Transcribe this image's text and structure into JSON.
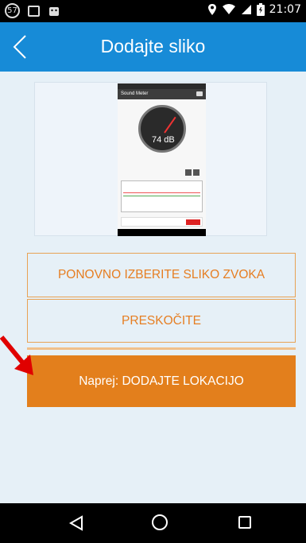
{
  "status_bar": {
    "badge": "57",
    "time": "21:07"
  },
  "app_bar": {
    "title": "Dodajte sliko"
  },
  "preview": {
    "phone_title": "Sound Meter",
    "reading": "74 dB"
  },
  "buttons": {
    "reselect": "PONOVNO IZBERITE SLIKO ZVOKA",
    "skip": "PRESKOČITE",
    "next": "Naprej: DODAJTE LOKACIJO"
  },
  "colors": {
    "app_bar": "#178bd7",
    "accent": "#e37f1c",
    "background": "#e6f0f7",
    "annotation_arrow": "#e00000"
  },
  "icons": {
    "back": "chevron-left-icon",
    "nav_back": "triangle-back-icon",
    "nav_home": "circle-home-icon",
    "nav_recent": "square-recents-icon"
  }
}
